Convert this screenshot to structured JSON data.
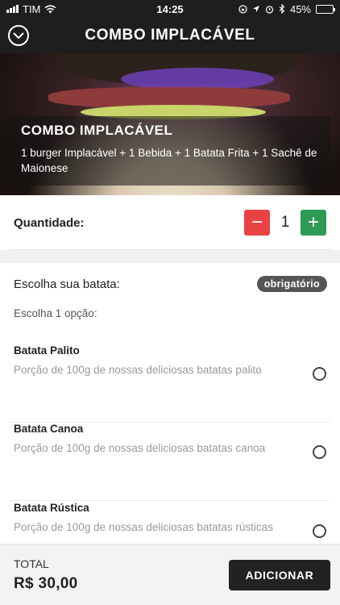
{
  "status_bar": {
    "carrier": "TIM",
    "time": "14:25",
    "battery": "45%"
  },
  "nav": {
    "title": "COMBO IMPLACÁVEL"
  },
  "hero": {
    "title": "COMBO IMPLACÁVEL",
    "description": "1 burger Implacável + 1 Bebida + 1 Batata Frita + 1 Sachê de Maionese"
  },
  "quantity": {
    "label": "Quantidade:",
    "minus": "−",
    "value": "1",
    "plus": "+"
  },
  "options": {
    "header": "Escolha sua batata:",
    "badge": "obrigatório",
    "subtitle": "Escolha 1 opção:",
    "items": [
      {
        "name": "Batata Palito",
        "description": "Porção de 100g de nossas deliciosas batatas palito"
      },
      {
        "name": "Batata Canoa",
        "description": "Porção de 100g de nossas deliciosas batatas canoa"
      },
      {
        "name": "Batata Rústica",
        "description": "Porção de 100g de nossas deliciosas batatas rústicas"
      }
    ]
  },
  "footer": {
    "total_label": "TOTAL",
    "total_value": "R$ 30,00",
    "add_button": "ADICIONAR"
  },
  "colors": {
    "minus": "#e84244",
    "plus": "#2e9a56",
    "header_bg": "#1e1e1e"
  },
  "icons": [
    "wifi-icon",
    "lock-rotation-icon",
    "location-icon",
    "alarm-icon",
    "bluetooth-icon",
    "battery-icon",
    "chevron-down-icon"
  ]
}
